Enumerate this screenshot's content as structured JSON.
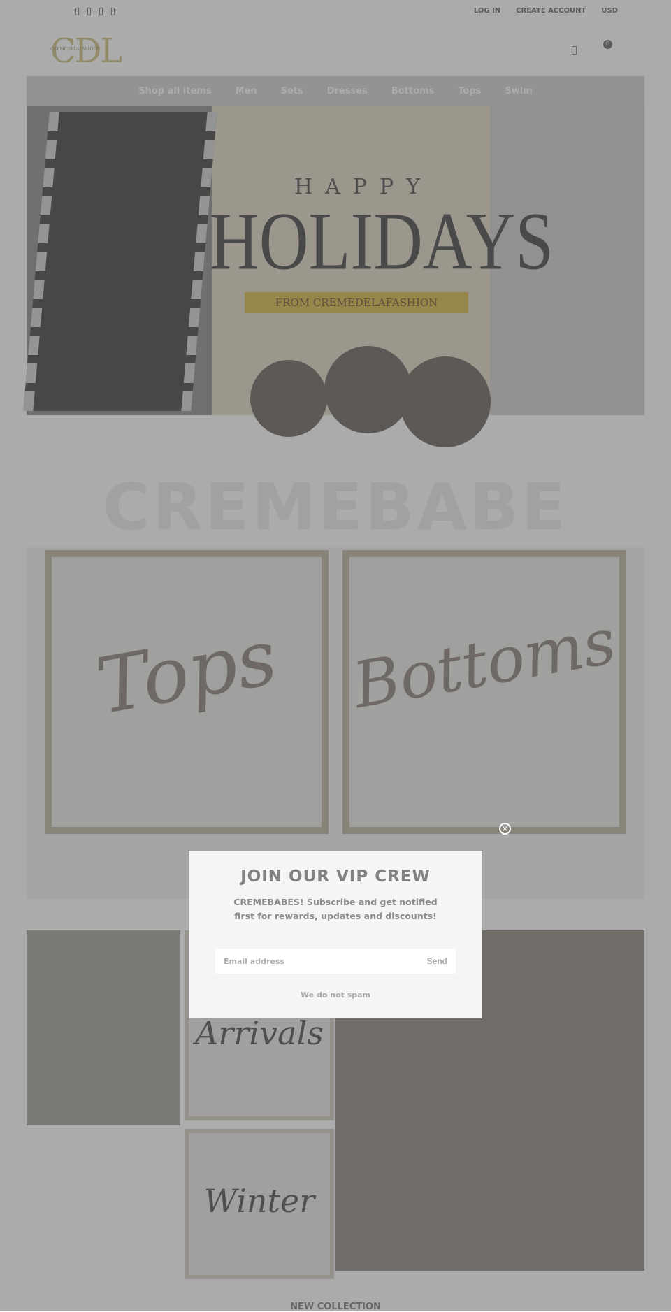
{
  "topbar": {
    "social_icons": [
      "facebook-icon",
      "instagram-icon",
      "twitter-icon",
      "pinterest-icon"
    ],
    "login": "LOG IN",
    "create_account": "CREATE ACCOUNT",
    "currency": "USD"
  },
  "header": {
    "logo": "CDL",
    "logo_sub": "CREMEDELAFASHION",
    "cart_count": "0"
  },
  "nav": {
    "items": [
      "Shop all items",
      "Men",
      "Sets",
      "Dresses",
      "Bottoms",
      "Tops",
      "Swim"
    ]
  },
  "hero": {
    "line1": "HAPPY",
    "line2": "HOLIDAYS",
    "line3": "FROM CREMEDELAFASHION"
  },
  "section": {
    "watermark": "CREMEBABE",
    "tiles": [
      "Tops",
      "Bottoms"
    ]
  },
  "grid": {
    "tiles": [
      "New Arrivals",
      "Winter"
    ]
  },
  "footer_heading": "NEW COLLECTION",
  "popup": {
    "title": "JOIN OUR VIP CREW",
    "text": "CREMEBABES! Subscribe and get notified first for rewards, updates and discounts!",
    "email_placeholder": "Email address",
    "send": "Send",
    "note": "We do not spam"
  },
  "colors": {
    "overlay": "#000000",
    "accent": "#d8cfa0"
  }
}
